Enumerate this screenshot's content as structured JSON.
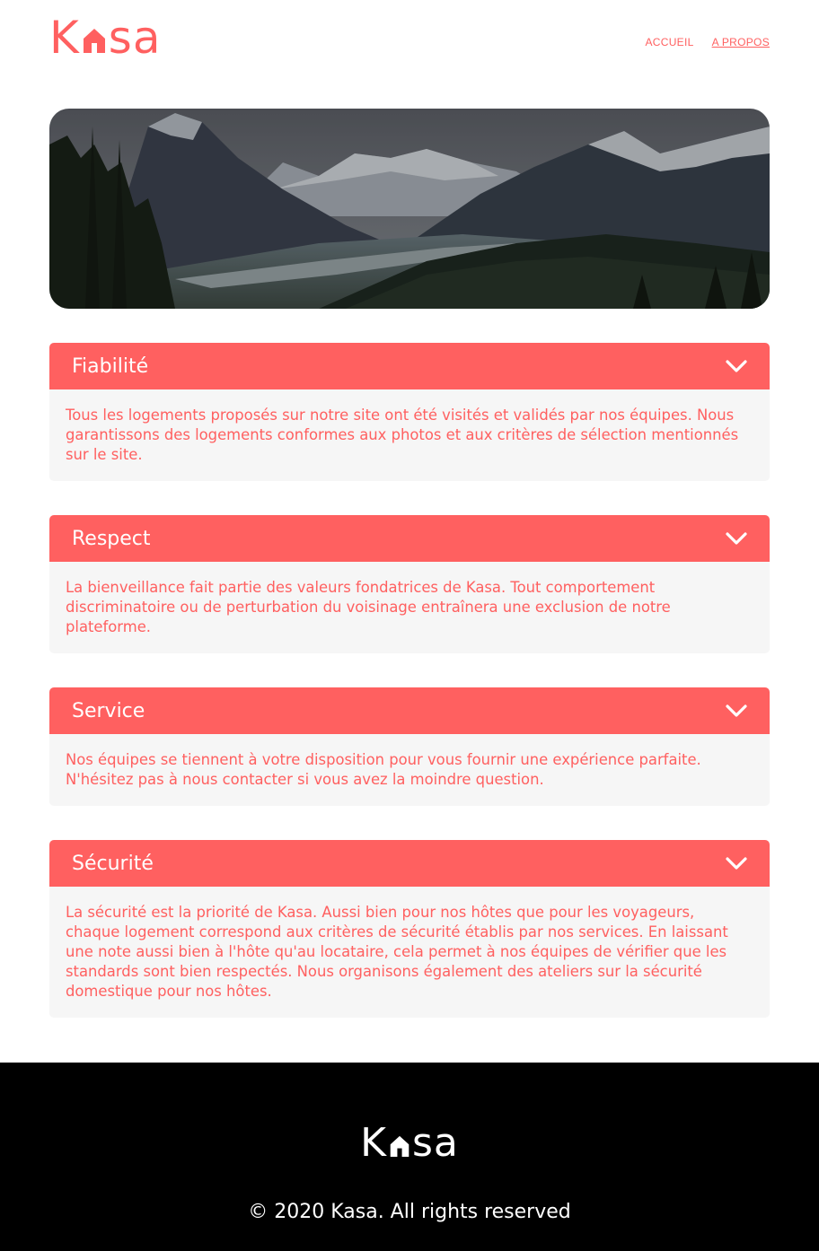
{
  "brand": {
    "logo_left": "K",
    "logo_right": "sa",
    "color": "#FF6060"
  },
  "nav": [
    {
      "label": "ACCUEIL"
    },
    {
      "label": "A PROPOS"
    }
  ],
  "sections": [
    {
      "title": "Fiabilité",
      "text": "Tous les logements proposés sur notre site ont été visités et validés par nos équipes. Nous garantissons des logements conformes aux photos et aux critères de sélection mentionnés sur le site."
    },
    {
      "title": "Respect",
      "text": "La bienveillance fait partie des valeurs fondatrices de Kasa. Tout comportement discriminatoire ou de perturbation du voisinage entraînera une exclusion de notre plateforme."
    },
    {
      "title": "Service",
      "text": "Nos équipes se tiennent à votre disposition pour vous fournir une expérience parfaite. N'hésitez pas à nous contacter si vous avez la moindre question."
    },
    {
      "title": "Sécurité",
      "text": "La sécurité est la priorité de Kasa. Aussi bien pour nos hôtes que pour les voyageurs, chaque logement correspond aux critères de sécurité établis par nos services. En laissant une note aussi bien à l'hôte qu'au locataire, cela permet à nos équipes de vérifier que les standards sont bien respectés. Nous organisons également des ateliers sur la sécurité domestique pour nos hôtes."
    }
  ],
  "icons": {
    "chevron": "chevron-down-icon",
    "logo": "house-icon"
  },
  "footer": {
    "copyright": "© 2020 Kasa. All rights reserved"
  }
}
